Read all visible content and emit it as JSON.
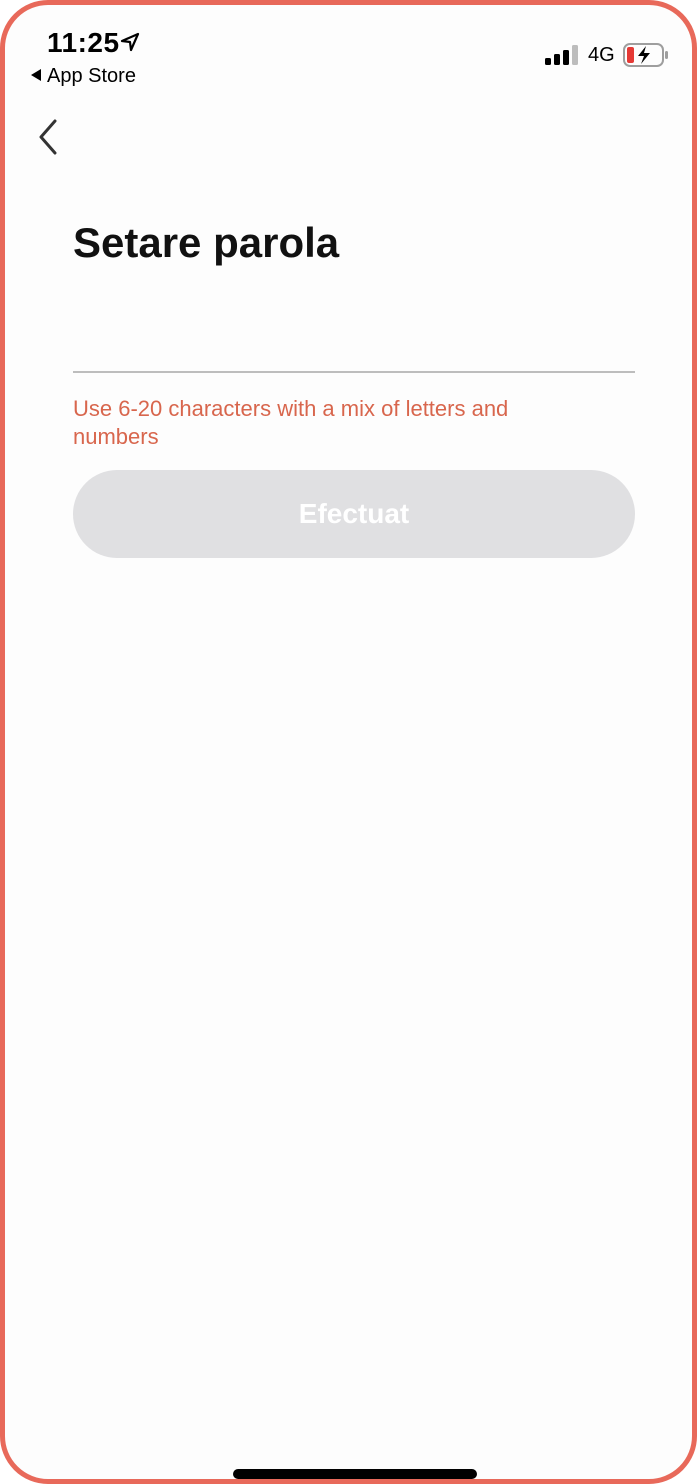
{
  "status_bar": {
    "time": "11:25",
    "back_app_label": "App Store",
    "network": "4G",
    "location_icon": "location-arrow-icon",
    "signal_icon": "cellular-signal-icon",
    "battery_icon": "battery-charging-icon",
    "battery_level": 0.2,
    "battery_color": "#e53935"
  },
  "nav": {
    "back_icon": "chevron-left-icon"
  },
  "page": {
    "title": "Setare parola",
    "password_value": "",
    "password_placeholder": "",
    "hint": "Use 6-20 characters with a mix of letters and numbers",
    "submit_label": "Efectuat"
  },
  "colors": {
    "frame": "#e8695a",
    "hint": "#d8664d",
    "button_disabled_bg": "#e0e0e2",
    "button_text": "#ffffff"
  }
}
